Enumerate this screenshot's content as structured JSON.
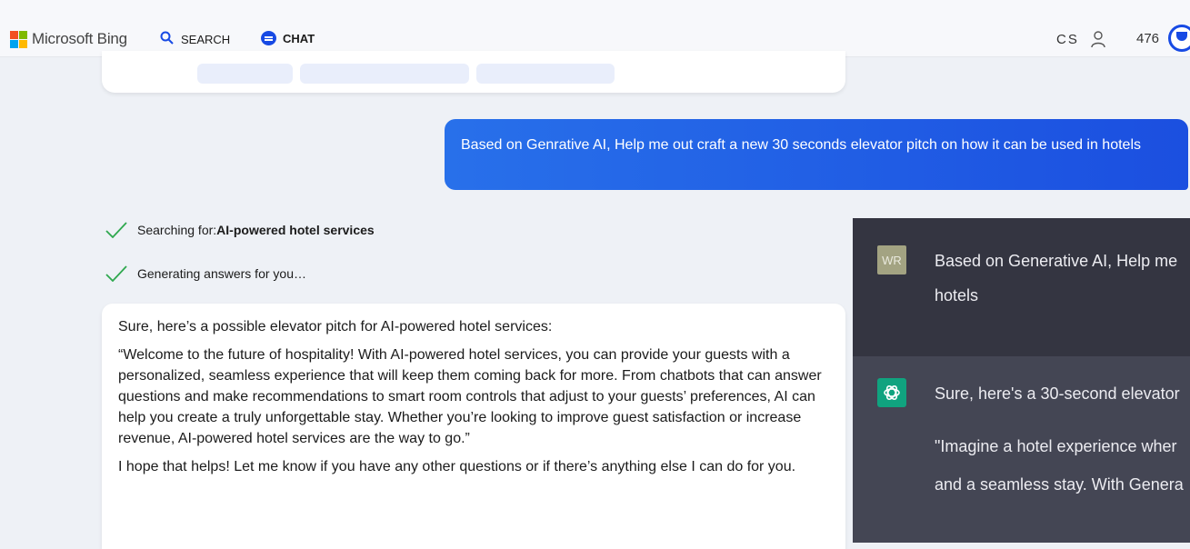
{
  "header": {
    "brand": "Microsoft Bing",
    "nav": [
      {
        "label": "SEARCH",
        "icon": "search-icon"
      },
      {
        "label": "CHAT",
        "icon": "chat-icon",
        "active": true
      }
    ],
    "user_initials": "CS",
    "points": "476",
    "accent_color": "#174ae4"
  },
  "chat": {
    "user_message": "Based on Genrative AI, Help me out craft a new 30 seconds elevator pitch on how it can be used in hotels",
    "status": [
      {
        "prefix": "Searching for: ",
        "query": "AI-powered hotel services"
      },
      {
        "prefix": "Generating answers for you…",
        "query": ""
      }
    ],
    "answer": {
      "intro": "Sure, here’s a possible elevator pitch for AI-powered hotel services:",
      "pitch": "“Welcome to the future of hospitality! With AI-powered hotel services, you can provide your guests with a personalized, seamless experience that will keep them coming back for more. From chatbots that can answer questions and make recommendations to smart room controls that adjust to your guests’ preferences, AI can help you create a truly unforgettable stay. Whether you’re looking to improve guest satisfaction or increase revenue, AI-powered hotel services are the way to go.”",
      "closing": "I hope that helps! Let me know if you have any other questions or if there’s anything else I can do for you."
    }
  },
  "chatgpt_overlay": {
    "user_avatar": "WR",
    "user_line1": "Based on Generative AI, Help me",
    "user_line2": "hotels",
    "assistant_lines": [
      "Sure, here's a 30-second elevator",
      "\"Imagine a hotel experience wher",
      "and a seamless stay. With Genera"
    ]
  }
}
